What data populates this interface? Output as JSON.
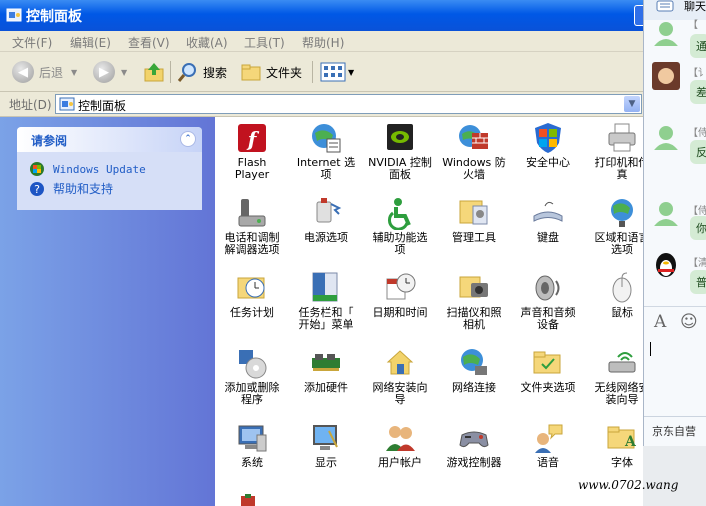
{
  "window": {
    "title": "控制面板"
  },
  "menu": [
    "文件(F)",
    "编辑(E)",
    "查看(V)",
    "收藏(A)",
    "工具(T)",
    "帮助(H)"
  ],
  "toolbar": {
    "back": "后退",
    "search": "搜索",
    "folders": "文件夹"
  },
  "address": {
    "label": "地址(D)",
    "value": "控制面板"
  },
  "see_also": {
    "title": "请参阅",
    "links": [
      "Windows Update",
      "帮助和支持"
    ]
  },
  "items": [
    [
      "Flash\nPlayer",
      "Internet 选\n项",
      "NVIDIA 控制\n面板",
      "Windows 防\n火墙",
      "安全中心",
      "打印机和传\n真"
    ],
    [
      "电话和调制\n解调器选项",
      "电源选项",
      "辅助功能选\n项",
      "管理工具",
      "键盘",
      "区域和语言\n选项"
    ],
    [
      "任务计划",
      "任务栏和「\n开始」菜单",
      "日期和时间",
      "扫描仪和照\n相机",
      "声音和音频\n设备",
      "鼠标"
    ],
    [
      "添加或删除\n程序",
      "添加硬件",
      "网络安装向\n导",
      "网络连接",
      "文件夹选项",
      "无线网络安\n装向导"
    ],
    [
      "系统",
      "显示",
      "用户帐户",
      "游戏控制器",
      "语音",
      "字体"
    ]
  ],
  "chat": {
    "header": "聊天",
    "names": [
      "【",
      "【讠",
      "【侍",
      "【侍",
      "【清"
    ],
    "bubbles": [
      "通",
      "差",
      "反",
      "你",
      "普"
    ],
    "bottom": "京东自营"
  },
  "watermark": "www.0702.wang",
  "colors": {
    "title_bar": "#0058e6",
    "left_pane": "#6f8ce0",
    "link": "#215dc6"
  }
}
